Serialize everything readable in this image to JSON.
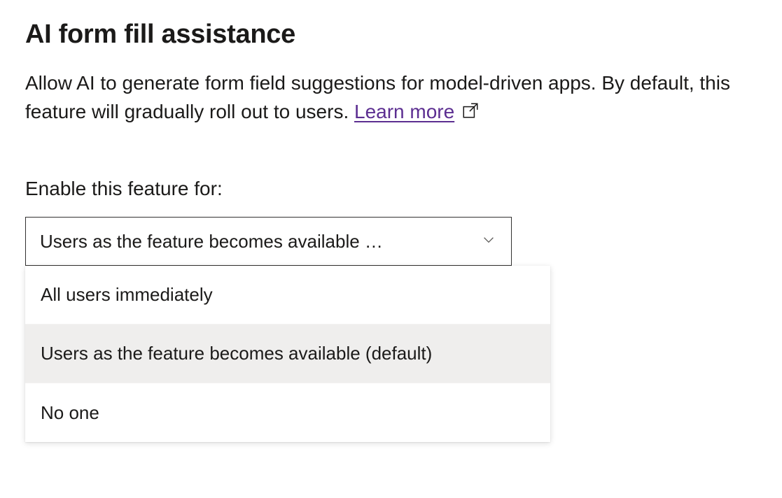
{
  "heading": "AI form fill assistance",
  "description_part1": "Allow AI to generate form field suggestions for model-driven apps. By default, this feature will gradually roll out to users. ",
  "learn_more_label": "Learn more",
  "field_label": "Enable this feature for:",
  "select": {
    "display_value": "Users as the feature becomes available …",
    "options": [
      {
        "label": "All users immediately",
        "selected": false
      },
      {
        "label": "Users as the feature becomes available (default)",
        "selected": true
      },
      {
        "label": "No one",
        "selected": false
      }
    ]
  },
  "colors": {
    "link": "#5c2e91",
    "text": "#1b1a19",
    "border": "#323130",
    "option_selected_bg": "#efeeed"
  }
}
